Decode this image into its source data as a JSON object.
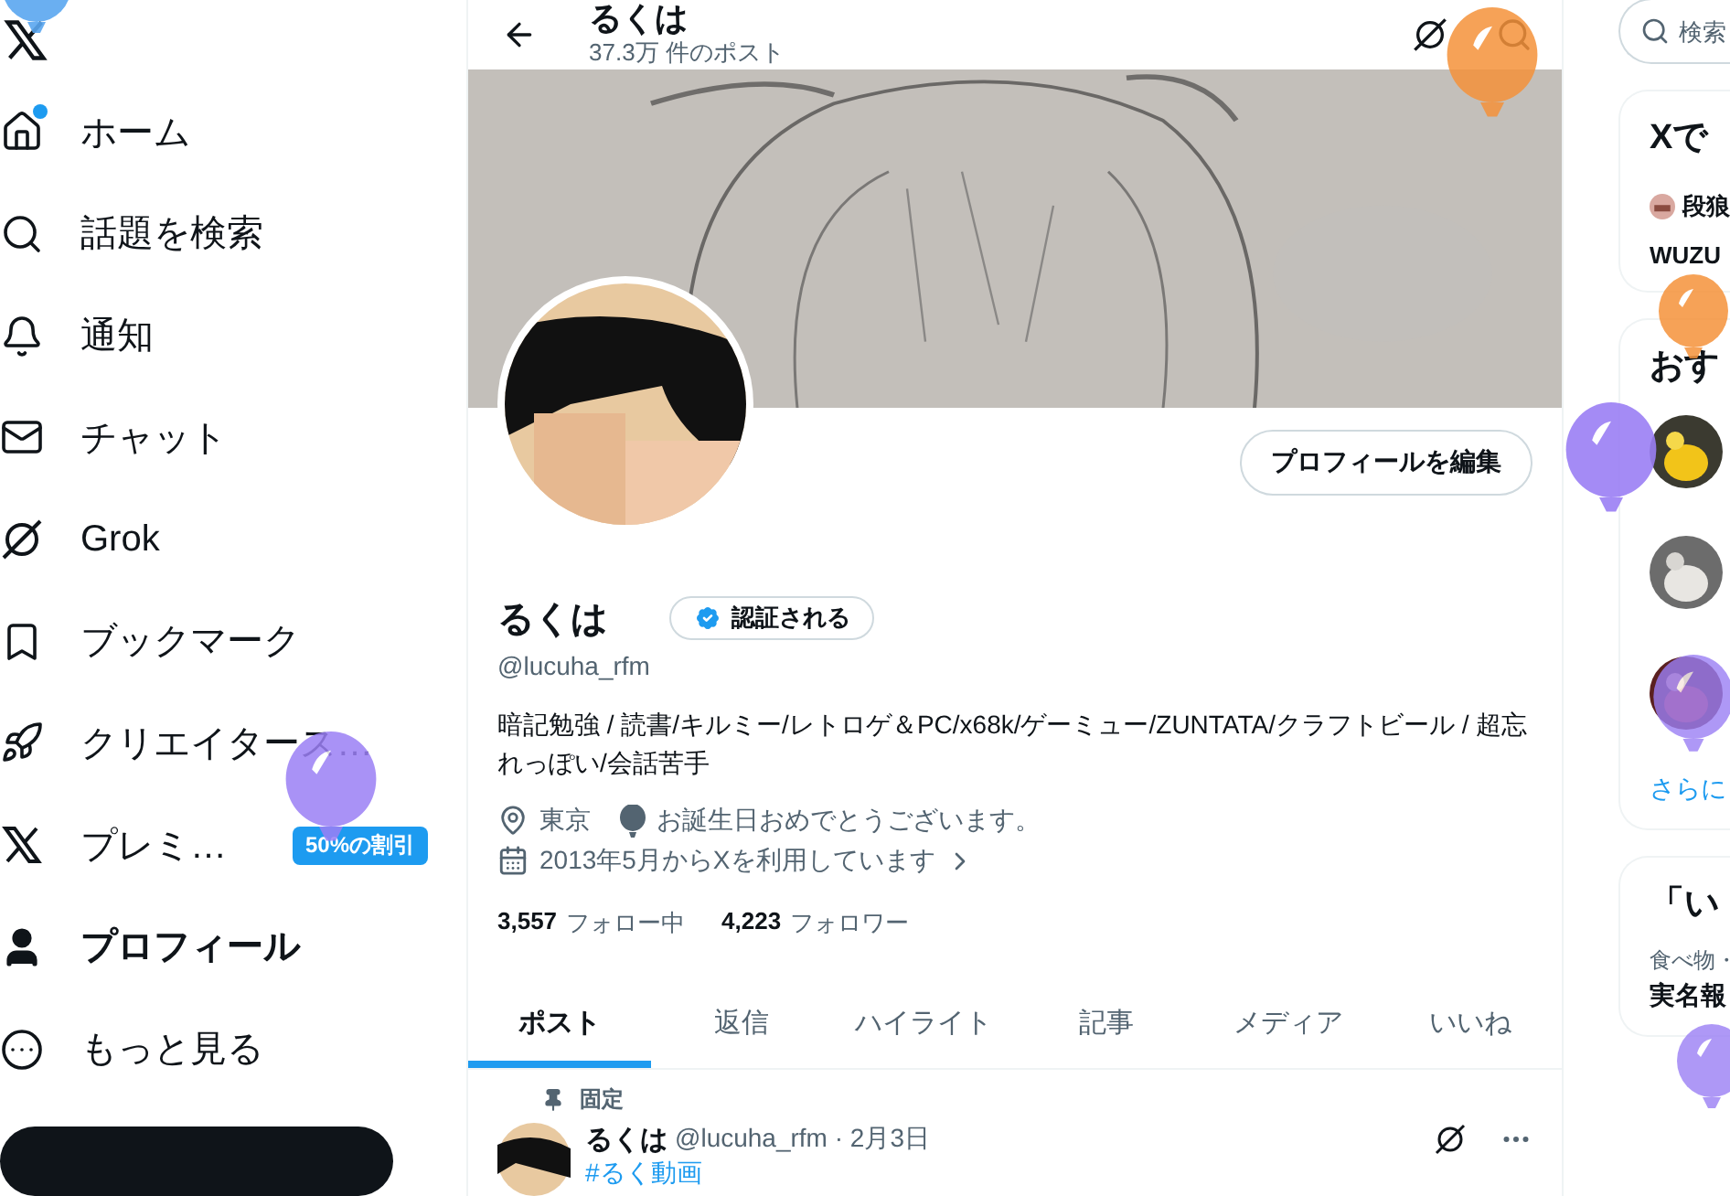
{
  "sidebar": {
    "items": [
      {
        "kind": "home",
        "label": "ホーム",
        "selected": false,
        "dot": true
      },
      {
        "kind": "search",
        "label": "話題を検索",
        "selected": false,
        "dot": false
      },
      {
        "kind": "bell",
        "label": "通知",
        "selected": false,
        "dot": false
      },
      {
        "kind": "mail",
        "label": "チャット",
        "selected": false,
        "dot": false
      },
      {
        "kind": "grok",
        "label": "Grok",
        "selected": false,
        "dot": false
      },
      {
        "kind": "bookmark",
        "label": "ブックマーク",
        "selected": false,
        "dot": false
      },
      {
        "kind": "rocket",
        "label": "クリエイタース…",
        "selected": false,
        "dot": false
      },
      {
        "kind": "x",
        "label": "プレミ…",
        "selected": false,
        "dot": false,
        "badge": "50%の割引"
      },
      {
        "kind": "user",
        "label": "プロフィール",
        "selected": true,
        "dot": false
      },
      {
        "kind": "more",
        "label": "もっと見る",
        "selected": false,
        "dot": false
      }
    ]
  },
  "header": {
    "title": "るくは",
    "post_count": "37.3万 件のポスト"
  },
  "profile": {
    "edit_button": "プロフィールを編集",
    "name": "るくは",
    "verify_button": "認証される",
    "handle": "@lucuha_rfm",
    "bio": "暗記勉強 / 読書/キルミー/レトロゲ＆PC/x68k/ゲーミュー/ZUNTATA/クラフトビール / 超忘れっぽい/会話苦手",
    "location": "東京",
    "birthday": "お誕生日おめでとうございます。",
    "joined": "2013年5月からXを利用しています",
    "following_count": "3,557",
    "following_label": "フォロー中",
    "followers_count": "4,223",
    "followers_label": "フォロワー"
  },
  "tabs": [
    {
      "label": "ポスト",
      "selected": true
    },
    {
      "label": "返信",
      "selected": false
    },
    {
      "label": "ハイライト",
      "selected": false
    },
    {
      "label": "記事",
      "selected": false
    },
    {
      "label": "メディア",
      "selected": false
    },
    {
      "label": "いいね",
      "selected": false
    }
  ],
  "pinned_post": {
    "pinned_label": "固定",
    "author": "るくは",
    "meta": "@lucuha_rfm · 2月3日",
    "hashtag": "#るく動画"
  },
  "right": {
    "search": {
      "placeholder": "検索"
    },
    "trending": {
      "title": "Xで",
      "user": "段狼",
      "text": "WUZU"
    },
    "who_to_follow": {
      "title": "おす",
      "more": "さらに"
    },
    "happening": {
      "title": "「い",
      "category": "食べ物・",
      "headline": "実名報"
    }
  }
}
